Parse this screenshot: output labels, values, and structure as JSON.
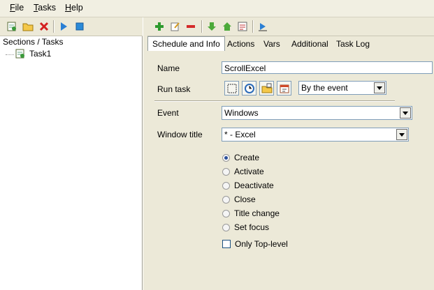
{
  "menubar": {
    "file": "File",
    "tasks": "Tasks",
    "help": "Help"
  },
  "tree": {
    "header": "Sections / Tasks",
    "items": [
      {
        "label": "Task1"
      }
    ]
  },
  "tabs": [
    {
      "label": "Schedule and Info",
      "active": true
    },
    {
      "label": "Actions"
    },
    {
      "label": "Vars"
    },
    {
      "label": "Additional"
    },
    {
      "label": "Task Log"
    }
  ],
  "form": {
    "name_label": "Name",
    "name_value": "ScrollExcel",
    "run_task_label": "Run task",
    "run_task_value": "By the event",
    "event_label": "Event",
    "event_value": "Windows",
    "window_title_label": "Window title",
    "window_title_value": "* - Excel",
    "options": [
      {
        "label": "Create",
        "selected": true
      },
      {
        "label": "Activate"
      },
      {
        "label": "Deactivate"
      },
      {
        "label": "Close"
      },
      {
        "label": "Title change"
      },
      {
        "label": "Set focus"
      }
    ],
    "only_top_level_label": "Only Top-level",
    "only_top_level_checked": false
  }
}
